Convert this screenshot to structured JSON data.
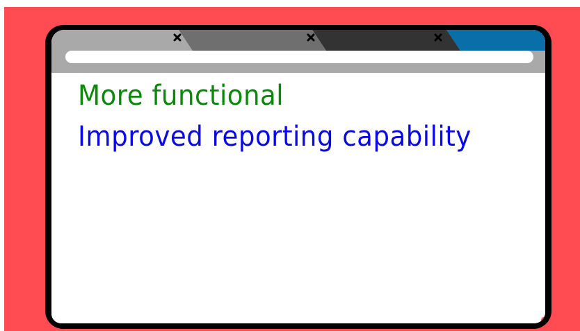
{
  "window": {
    "tabs": [
      {
        "name": "tab-1",
        "fill": "#a9a9a9",
        "close_glyph": "✕",
        "close_icon": "close-icon"
      },
      {
        "name": "tab-2",
        "fill": "#6f6f6f",
        "close_glyph": "✕",
        "close_icon": "close-icon"
      },
      {
        "name": "tab-3",
        "fill": "#333333",
        "close_glyph": "✕",
        "close_icon": "close-icon"
      },
      {
        "name": "tab-4",
        "fill": "#0a6fa8"
      }
    ],
    "address_bar_value": ""
  },
  "content": {
    "line_1": "More functional",
    "line_2": "Improved reporting capability"
  },
  "colors": {
    "background": "#ff4c52",
    "window_frame": "#000000",
    "chrome": "#a9a9a9",
    "line_1": "#0a8a0a",
    "line_2": "#0a0ae6",
    "active_tab": "#0a6fa8"
  }
}
